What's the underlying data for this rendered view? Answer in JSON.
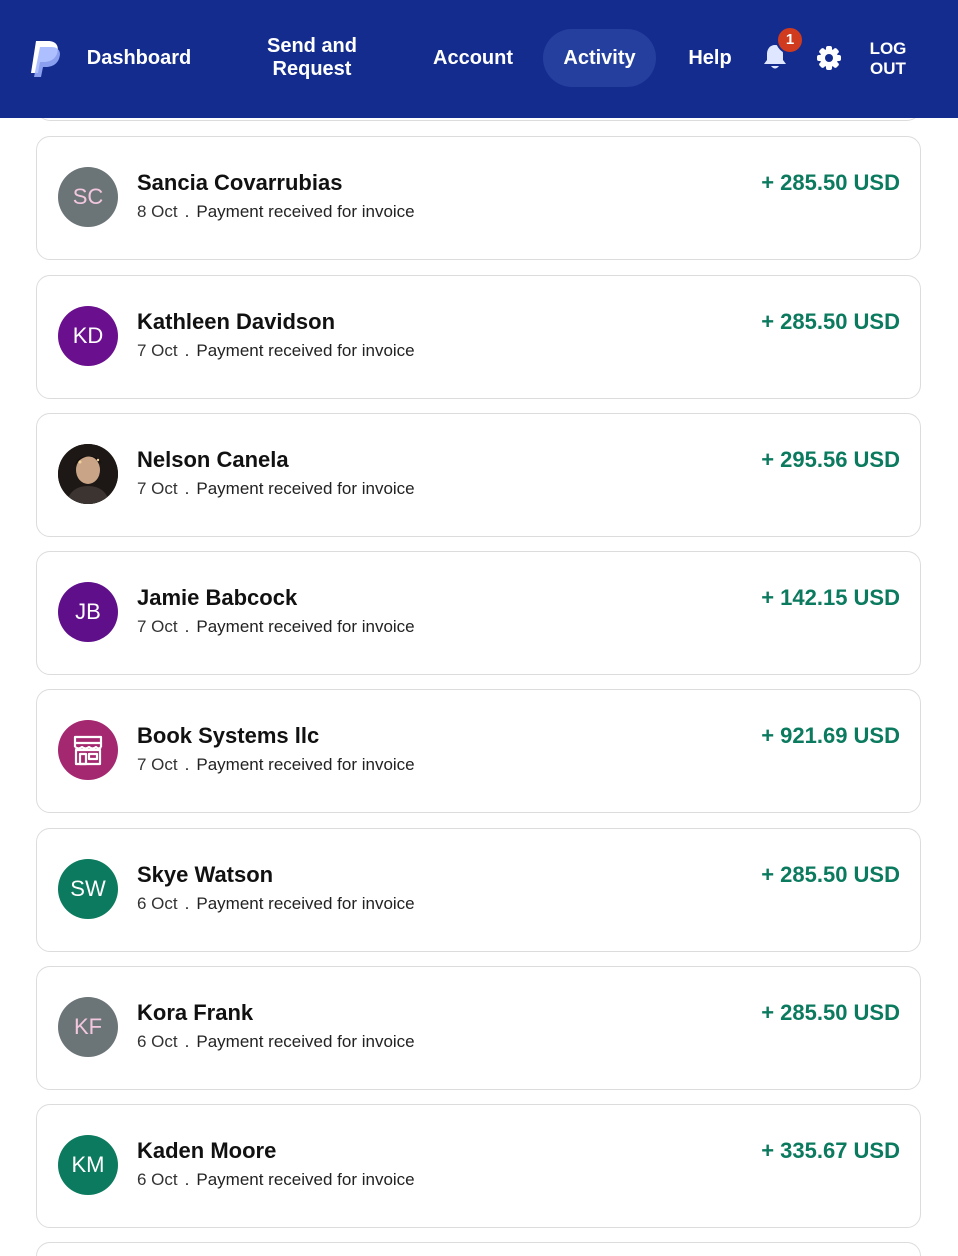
{
  "nav": {
    "dashboard": "Dashboard",
    "send_request": "Send and Request",
    "account": "Account",
    "activity": "Activity",
    "help": "Help",
    "notification_count": "1",
    "logout": "LOG OUT",
    "icons": [
      "paypal-logo",
      "bell-icon",
      "gear-icon"
    ]
  },
  "colors": {
    "nav_bg": "#142c8e",
    "active_pill": "#253f9f",
    "badge": "#d03b1f",
    "amount": "#0b7a5e"
  },
  "transactions": [
    {
      "initials": "SC",
      "avatar_bg": "#6b7477",
      "initials_color": "#f2c7df",
      "name": "Sancia Covarrubias",
      "date": "8 Oct",
      "description": "Payment received for invoice",
      "amount": "+ 285.50 USD"
    },
    {
      "initials": "KD",
      "avatar_bg": "#6a0f8e",
      "initials_color": "#ffffff",
      "name": "Kathleen Davidson",
      "date": "7 Oct",
      "description": "Payment received for invoice",
      "amount": "+ 285.50 USD"
    },
    {
      "initials": "",
      "avatar_type": "photo",
      "name": "Nelson Canela",
      "date": "7 Oct",
      "description": "Payment received for invoice",
      "amount": "+ 295.56 USD"
    },
    {
      "initials": "JB",
      "avatar_bg": "#5f0f8a",
      "initials_color": "#ffffff",
      "name": "Jamie Babcock",
      "date": "7 Oct",
      "description": "Payment received for invoice",
      "amount": "+ 142.15 USD"
    },
    {
      "initials": "",
      "avatar_type": "store-icon",
      "avatar_bg": "#a4286f",
      "name": "Book Systems llc",
      "date": "7 Oct",
      "description": "Payment received for invoice",
      "amount": "+ 921.69 USD"
    },
    {
      "initials": "SW",
      "avatar_bg": "#0b7a5e",
      "initials_color": "#ffffff",
      "name": "Skye Watson",
      "date": "6 Oct",
      "description": "Payment received for invoice",
      "amount": "+ 285.50 USD"
    },
    {
      "initials": "KF",
      "avatar_bg": "#6b7477",
      "initials_color": "#f2c7df",
      "name": "Kora Frank",
      "date": "6 Oct",
      "description": "Payment received for invoice",
      "amount": "+ 285.50 USD"
    },
    {
      "initials": "KM",
      "avatar_bg": "#0b7a5e",
      "initials_color": "#ffffff",
      "name": "Kaden Moore",
      "date": "6 Oct",
      "description": "Payment received for invoice",
      "amount": "+ 335.67 USD"
    }
  ]
}
